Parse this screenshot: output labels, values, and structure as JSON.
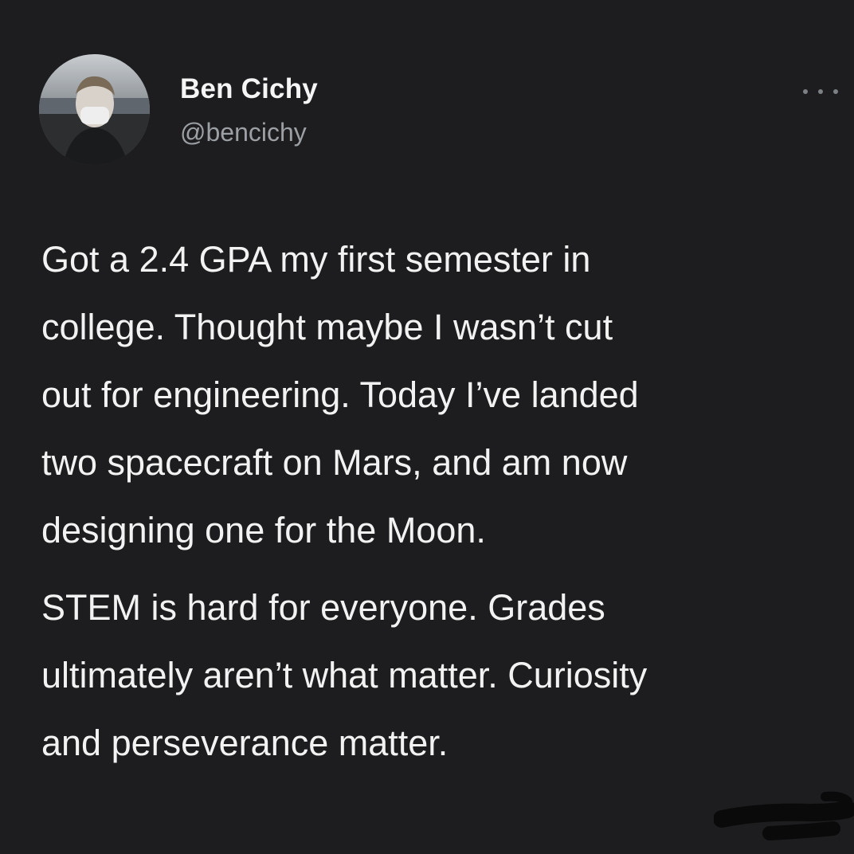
{
  "user": {
    "display_name": "Ben Cichy",
    "handle": "@bencichy",
    "avatar_icon": "profile-photo"
  },
  "menu": {
    "icon": "more-options-icon"
  },
  "tweet": {
    "paragraphs": [
      [
        "Got a 2.4 GPA my first semester in",
        "college. Thought maybe I wasn’t cut",
        "out for engineering. Today I’ve landed",
        "two spacecraft on Mars, and am now",
        "designing one for the Moon."
      ],
      [
        "STEM is hard for everyone. Grades",
        "ultimately aren’t what matter.  Curiosity",
        "and perseverance matter."
      ]
    ]
  },
  "colors": {
    "background": "#1d1d1f",
    "text": "#f2f2f2",
    "handle": "#9c9fa3",
    "icon": "#7d8084"
  }
}
